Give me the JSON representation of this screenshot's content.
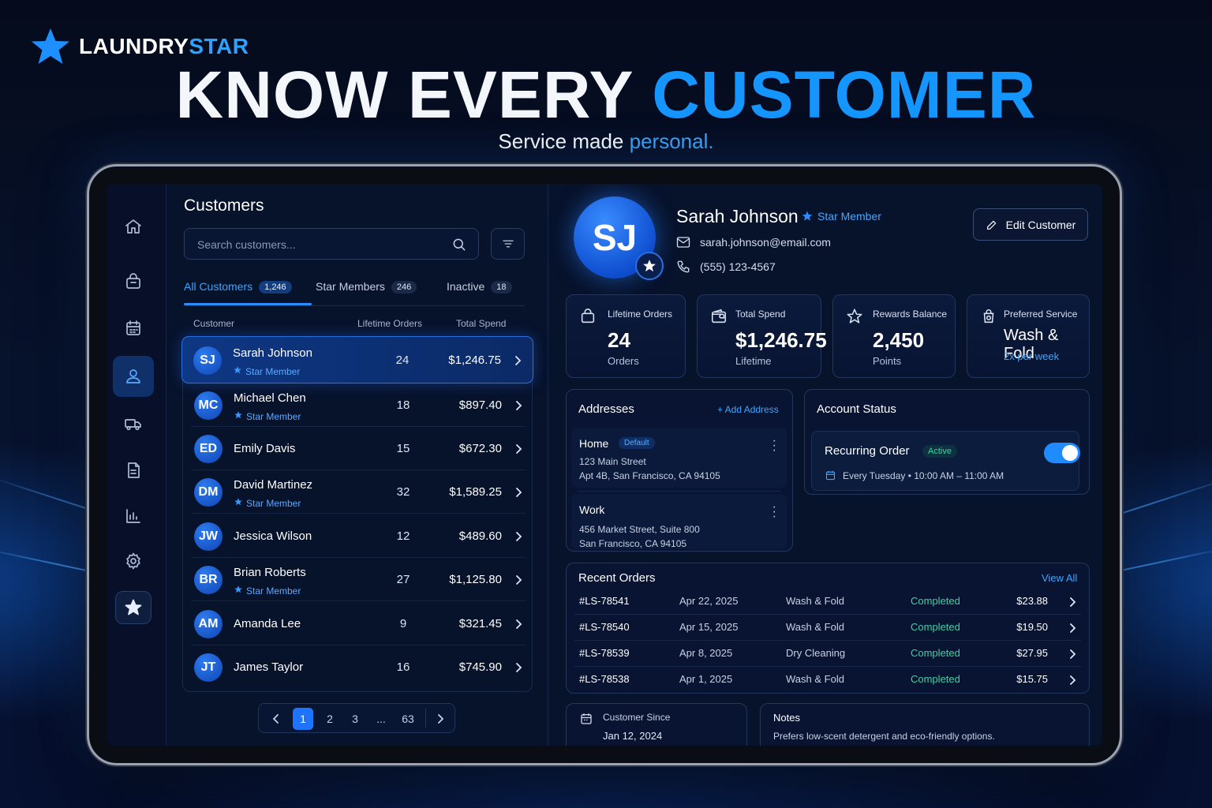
{
  "brand": {
    "name_part1": "LAUNDRY",
    "name_part2": "STAR"
  },
  "hero": {
    "headline_part1": "KNOW EVERY",
    "headline_part2": "CUSTOMER",
    "subline_part1": "Service made",
    "subline_part2": "personal."
  },
  "colors": {
    "accent": "#1596ff",
    "background": "#07122b",
    "success": "#3fd0a5",
    "active_row": "#0e3784"
  },
  "sidebar": {
    "items": [
      {
        "icon": "home-icon"
      },
      {
        "icon": "shopping-bag-icon"
      },
      {
        "icon": "calendar-icon"
      },
      {
        "icon": "customer-icon",
        "active": true
      },
      {
        "icon": "delivery-truck-icon"
      },
      {
        "icon": "document-icon"
      },
      {
        "icon": "bar-chart-icon"
      },
      {
        "icon": "gear-icon"
      },
      {
        "icon": "star-icon"
      }
    ]
  },
  "customers": {
    "title": "Customers",
    "search_placeholder": "Search customers...",
    "tabs": [
      {
        "label": "All Customers",
        "count": "1,246",
        "active": true
      },
      {
        "label": "Star Members",
        "count": "246"
      },
      {
        "label": "Inactive",
        "count": "18"
      }
    ],
    "columns": {
      "customer": "Customer",
      "orders": "Lifetime Orders",
      "spend": "Total Spend"
    },
    "star_label": "Star Member",
    "rows": [
      {
        "initials": "SJ",
        "name": "Sarah Johnson",
        "star": true,
        "orders": "24",
        "spend": "$1,246.75",
        "selected": true
      },
      {
        "initials": "MC",
        "name": "Michael Chen",
        "star": true,
        "orders": "18",
        "spend": "$897.40"
      },
      {
        "initials": "ED",
        "name": "Emily Davis",
        "star": false,
        "orders": "15",
        "spend": "$672.30"
      },
      {
        "initials": "DM",
        "name": "David Martinez",
        "star": true,
        "orders": "32",
        "spend": "$1,589.25"
      },
      {
        "initials": "JW",
        "name": "Jessica Wilson",
        "star": false,
        "orders": "12",
        "spend": "$489.60"
      },
      {
        "initials": "BR",
        "name": "Brian Roberts",
        "star": true,
        "orders": "27",
        "spend": "$1,125.80"
      },
      {
        "initials": "AM",
        "name": "Amanda Lee",
        "star": false,
        "orders": "9",
        "spend": "$321.45"
      },
      {
        "initials": "JT",
        "name": "James Taylor",
        "star": false,
        "orders": "16",
        "spend": "$745.90"
      }
    ],
    "pagination": {
      "pages": [
        "1",
        "2",
        "3",
        "...",
        "63"
      ],
      "current": "1"
    }
  },
  "profile": {
    "initials": "SJ",
    "name": "Sarah Johnson",
    "badge": "Star Member",
    "email": "sarah.johnson@email.com",
    "phone": "(555) 123-4567",
    "edit_label": "Edit Customer",
    "stats": [
      {
        "icon": "shopping-bag-icon",
        "label": "Lifetime Orders",
        "value": "24",
        "sub": "Orders"
      },
      {
        "icon": "wallet-icon",
        "label": "Total Spend",
        "value": "$1,246.75",
        "sub": "Lifetime"
      },
      {
        "icon": "star-outline-icon",
        "label": "Rewards Balance",
        "value": "2,450",
        "sub": "Points"
      },
      {
        "icon": "laundry-bag-icon",
        "label": "Preferred Service",
        "value": "Wash & Fold",
        "sub": "2x per week"
      }
    ],
    "addresses": {
      "title": "Addresses",
      "add_label": "+ Add Address",
      "items": [
        {
          "name": "Home",
          "tag": "Default",
          "line1": "123 Main Street",
          "line2": "Apt 4B, San Francisco, CA 94105"
        },
        {
          "name": "Work",
          "tag": "",
          "line1": "456 Market Street, Suite 800",
          "line2": "San Francisco, CA 94105"
        }
      ]
    },
    "account_status": {
      "title": "Account Status",
      "recurring_label": "Recurring Order",
      "recurring_state": "Active",
      "schedule": "Every Tuesday • 10:00 AM – 11:00 AM",
      "toggle_on": true
    },
    "recent_orders": {
      "title": "Recent Orders",
      "view_all": "View All",
      "rows": [
        {
          "id": "#LS-78541",
          "date": "Apr 22, 2025",
          "service": "Wash & Fold",
          "status": "Completed",
          "total": "$23.88"
        },
        {
          "id": "#LS-78540",
          "date": "Apr 15, 2025",
          "service": "Wash & Fold",
          "status": "Completed",
          "total": "$19.50"
        },
        {
          "id": "#LS-78539",
          "date": "Apr 8, 2025",
          "service": "Dry Cleaning",
          "status": "Completed",
          "total": "$27.95"
        },
        {
          "id": "#LS-78538",
          "date": "Apr 1, 2025",
          "service": "Wash & Fold",
          "status": "Completed",
          "total": "$15.75"
        }
      ]
    },
    "customer_since": {
      "label": "Customer Since",
      "value": "Jan 12, 2024"
    },
    "notes": {
      "title": "Notes",
      "text": "Prefers low-scent detergent and eco-friendly options."
    }
  }
}
